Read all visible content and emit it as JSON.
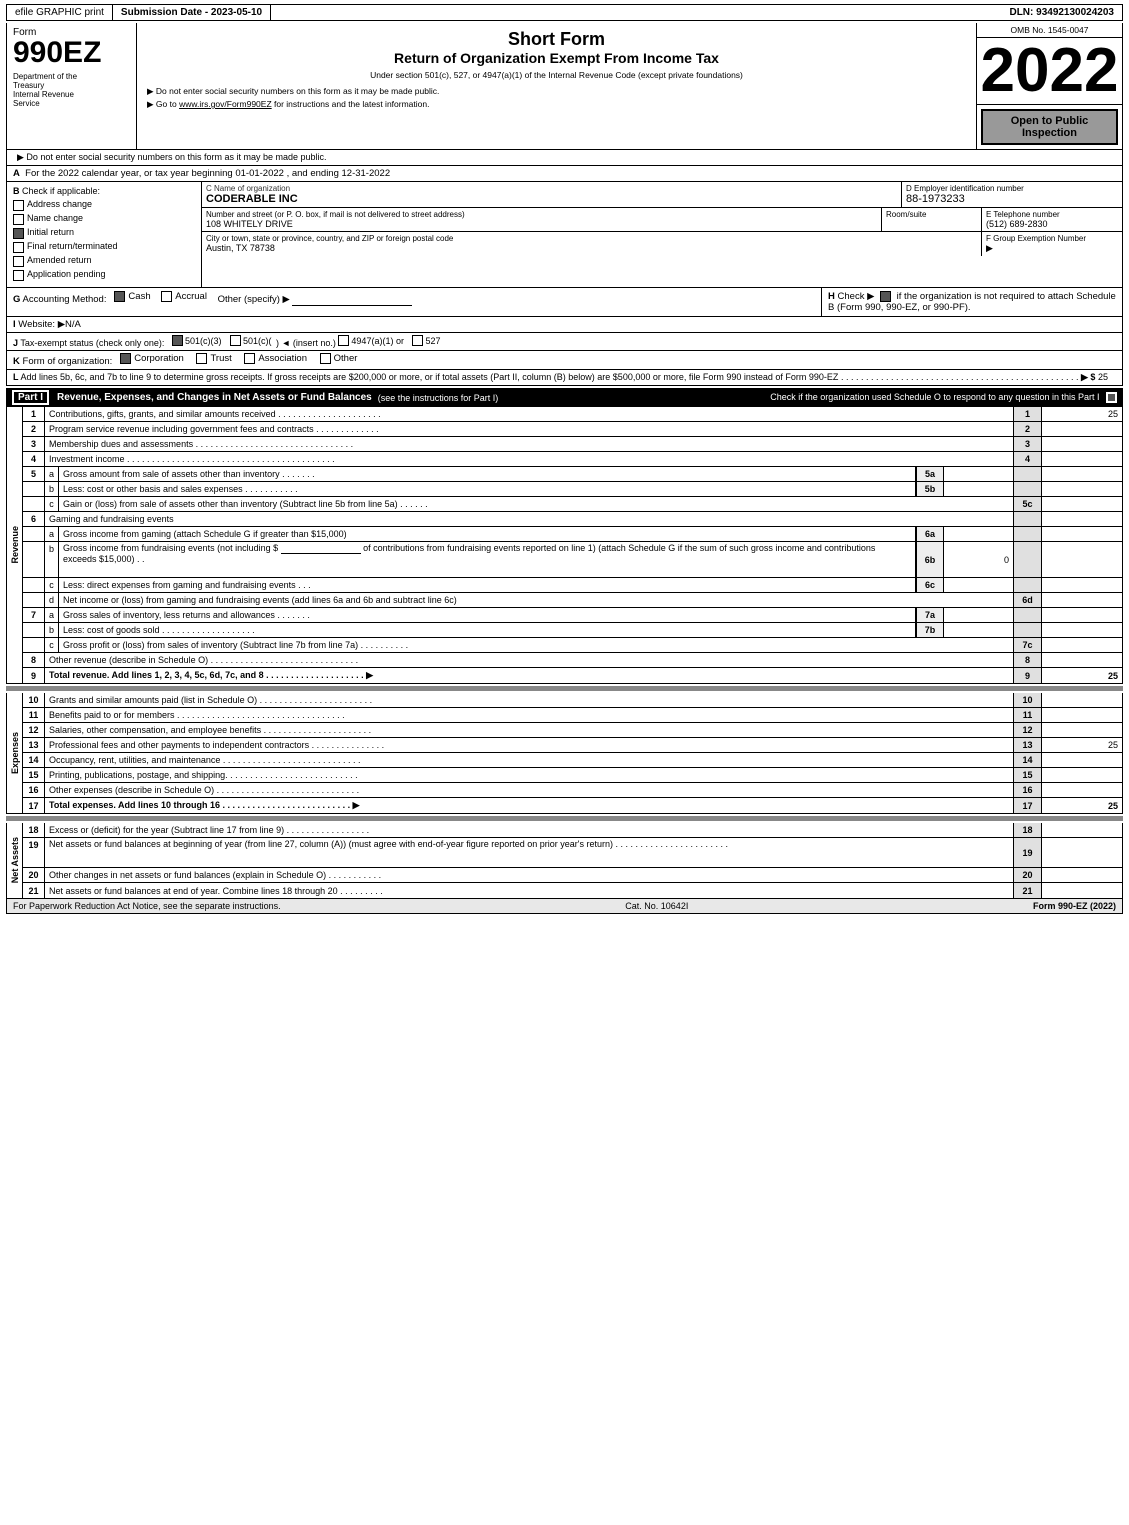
{
  "header": {
    "efile": "efile GRAPHIC print",
    "submission_date_label": "Submission Date - 2023-05-10",
    "dln": "DLN: 93492130024203",
    "form_number": "990EZ",
    "short_form": "Short Form",
    "return_title": "Return of Organization Exempt From Income Tax",
    "under_text": "Under section 501(c), 527, or 4947(a)(1) of the Internal Revenue Code (except private foundations)",
    "ssn_notice": "▶ Do not enter social security numbers on this form as it may be made public.",
    "irs_link": "▶ Go to www.irs.gov/Form990EZ for instructions and the latest information.",
    "year": "2022",
    "omb_label": "OMB No. 1545-0047",
    "open_to_public": "Open to Public Inspection",
    "dept_line1": "Department of the",
    "dept_line2": "Treasury",
    "dept_line3": "Internal Revenue",
    "dept_line4": "Service"
  },
  "section_a": {
    "label": "A",
    "text": "For the 2022 calendar year, or tax year beginning 01-01-2022 , and ending 12-31-2022"
  },
  "section_b": {
    "label": "B",
    "text": "Check if applicable:",
    "items": [
      {
        "label": "Address change",
        "checked": false
      },
      {
        "label": "Name change",
        "checked": false
      },
      {
        "label": "Initial return",
        "checked": true
      },
      {
        "label": "Final return/terminated",
        "checked": false
      },
      {
        "label": "Amended return",
        "checked": false
      },
      {
        "label": "Application pending",
        "checked": false
      }
    ]
  },
  "org": {
    "name_label": "C Name of organization",
    "name": "CODERABLE INC",
    "ein_label": "D Employer identification number",
    "ein": "88-1973233",
    "address_label": "Number and street (or P. O. box, if mail is not delivered to street address)",
    "address": "108 WHITELY DRIVE",
    "room_label": "Room/suite",
    "room": "",
    "phone_label": "E Telephone number",
    "phone": "(512) 689-2830",
    "city_label": "City or town, state or province, country, and ZIP or foreign postal code",
    "city": "Austin, TX  78738",
    "group_label": "F Group Exemption Number",
    "group_arrow": "▶"
  },
  "section_g": {
    "label": "G",
    "text": "Accounting Method:",
    "cash_checked": true,
    "accrual_checked": false,
    "other_text": "Other (specify) ▶"
  },
  "section_h": {
    "label": "H",
    "text": "Check ▶",
    "checked": true,
    "desc": "if the organization is not required to attach Schedule B (Form 990, 990-EZ, or 990-PF)."
  },
  "section_i": {
    "label": "I",
    "text": "Website: ▶N/A"
  },
  "section_j": {
    "label": "J",
    "text": "Tax-exempt status (check only one):",
    "options": [
      {
        "label": "501(c)(3)",
        "checked": true
      },
      {
        "label": "501(c)(",
        "checked": false
      },
      {
        "label": ") ◄ (insert no.)",
        "checked": false
      },
      {
        "label": "4947(a)(1) or",
        "checked": false
      },
      {
        "label": "527",
        "checked": false
      }
    ]
  },
  "section_k": {
    "label": "K",
    "text": "Form of organization:",
    "options": [
      {
        "label": "Corporation",
        "checked": true
      },
      {
        "label": "Trust",
        "checked": false
      },
      {
        "label": "Association",
        "checked": false
      },
      {
        "label": "Other",
        "checked": false
      }
    ]
  },
  "section_l": {
    "label": "L",
    "text": "Add lines 5b, 6c, and 7b to line 9 to determine gross receipts. If gross receipts are $200,000 or more, or if total assets (Part II, column (B) below) are $500,000 or more, file Form 990 instead of Form 990-EZ",
    "dots": ". . . . . . . . . . . . . . . . . . . . . . . . . . . . . . . . . . . . . . . . . . . . . . . .",
    "arrow": "▶ $",
    "amount": "25"
  },
  "part1": {
    "label": "Part I",
    "title": "Revenue, Expenses, and Changes in Net Assets or Fund Balances",
    "see_instructions": "(see the instructions for Part I)",
    "schedule_o_text": "Check if the organization used Schedule O to respond to any question in this Part I",
    "schedule_o_checked": true,
    "rows": [
      {
        "num": "1",
        "sub": "",
        "desc": "Contributions, gifts, grants, and similar amounts received . . . . . . . . . . . . . . . . . . . . .",
        "field": "1",
        "amount": "25"
      },
      {
        "num": "2",
        "sub": "",
        "desc": "Program service revenue including government fees and contracts . . . . . . . . . . . . .",
        "field": "2",
        "amount": ""
      },
      {
        "num": "3",
        "sub": "",
        "desc": "Membership dues and assessments . . . . . . . . . . . . . . . . . . . . . . . . . . . . . . . .",
        "field": "3",
        "amount": ""
      },
      {
        "num": "4",
        "sub": "",
        "desc": "Investment income . . . . . . . . . . . . . . . . . . . . . . . . . . . . . . . . . . . . . . . . . .",
        "field": "4",
        "amount": ""
      },
      {
        "num": "5",
        "sub": "a",
        "desc": "Gross amount from sale of assets other than inventory . . . . . . .",
        "inline_label": "5a",
        "field": "",
        "amount": ""
      },
      {
        "num": "",
        "sub": "b",
        "desc": "Less: cost or other basis and sales expenses . . . . . . . . . . . .",
        "inline_label": "5b",
        "field": "",
        "amount": ""
      },
      {
        "num": "",
        "sub": "c",
        "desc": "Gain or (loss) from sale of assets other than inventory (Subtract line 5b from line 5a) . . . . . .",
        "field": "5c",
        "amount": ""
      },
      {
        "num": "6",
        "sub": "",
        "desc": "Gaming and fundraising events",
        "field": "",
        "amount": ""
      },
      {
        "num": "",
        "sub": "a",
        "desc": "Gross income from gaming (attach Schedule G if greater than $15,000)",
        "inline_label": "6a",
        "field": "",
        "amount": ""
      },
      {
        "num": "",
        "sub": "b",
        "desc": "Gross income from fundraising events (not including $ ______________ of contributions from fundraising events reported on line 1) (attach Schedule G if the sum of such gross income and contributions exceeds $15,000)  .  .",
        "inline_label": "6b",
        "inline_val": "0",
        "field": "",
        "amount": ""
      },
      {
        "num": "",
        "sub": "c",
        "desc": "Less: direct expenses from gaming and fundraising events  .  .  .",
        "inline_label": "6c",
        "field": "",
        "amount": ""
      },
      {
        "num": "",
        "sub": "d",
        "desc": "Net income or (loss) from gaming and fundraising events (add lines 6a and 6b and subtract line 6c)",
        "field": "6d",
        "amount": ""
      },
      {
        "num": "7",
        "sub": "a",
        "desc": "Gross sales of inventory, less returns and allowances . . . . . . .",
        "inline_label": "7a",
        "field": "",
        "amount": ""
      },
      {
        "num": "",
        "sub": "b",
        "desc": "Less: cost of goods sold  .  .  .  .  .  .  .  .  .  .  .  .  .  .  .  .  .  .  .",
        "inline_label": "7b",
        "field": "",
        "amount": ""
      },
      {
        "num": "",
        "sub": "c",
        "desc": "Gross profit or (loss) from sales of inventory (Subtract line 7b from line 7a) . . . . . . . . . .",
        "field": "7c",
        "amount": ""
      },
      {
        "num": "8",
        "sub": "",
        "desc": "Other revenue (describe in Schedule O) . . . . . . . . . . . . . . . . . . . . . . . . . . . . . .",
        "field": "8",
        "amount": ""
      },
      {
        "num": "9",
        "sub": "",
        "desc": "Total revenue. Add lines 1, 2, 3, 4, 5c, 6d, 7c, and 8 . . . . . . . . . . . . . . . . . . . . ▶",
        "field": "9",
        "amount": "25",
        "bold": true
      }
    ]
  },
  "expenses_rows": [
    {
      "num": "10",
      "desc": "Grants and similar amounts paid (list in Schedule O) . . . . . . . . . . . . . . . . . . . . . . .",
      "field": "10",
      "amount": ""
    },
    {
      "num": "11",
      "desc": "Benefits paid to or for members . . . . . . . . . . . . . . . . . . . . . . . . . . . . . . . . . .",
      "field": "11",
      "amount": ""
    },
    {
      "num": "12",
      "desc": "Salaries, other compensation, and employee benefits . . . . . . . . . . . . . . . . . . . . . .",
      "field": "12",
      "amount": ""
    },
    {
      "num": "13",
      "desc": "Professional fees and other payments to independent contractors . . . . . . . . . . . . . . .",
      "field": "13",
      "amount": "25"
    },
    {
      "num": "14",
      "desc": "Occupancy, rent, utilities, and maintenance . . . . . . . . . . . . . . . . . . . . . . . . . . . .",
      "field": "14",
      "amount": ""
    },
    {
      "num": "15",
      "desc": "Printing, publications, postage, and shipping. . . . . . . . . . . . . . . . . . . . . . . . . . .",
      "field": "15",
      "amount": ""
    },
    {
      "num": "16",
      "desc": "Other expenses (describe in Schedule O) . . . . . . . . . . . . . . . . . . . . . . . . . . . . .",
      "field": "16",
      "amount": ""
    },
    {
      "num": "17",
      "desc": "Total expenses. Add lines 10 through 16  . . . . . . . . . . . . . . . . . . . . . . . . . . ▶",
      "field": "17",
      "amount": "25",
      "bold": true
    }
  ],
  "net_assets_rows": [
    {
      "num": "18",
      "desc": "Excess or (deficit) for the year (Subtract line 17 from line 9) . . . . . . . . . . . . . . . . .",
      "field": "18",
      "amount": ""
    },
    {
      "num": "19",
      "desc": "Net assets or fund balances at beginning of year (from line 27, column (A)) (must agree with end-of-year figure reported on prior year's return) . . . . . . . . . . . . . . . . . . . . . . .",
      "field": "19",
      "amount": "",
      "multiline": true
    },
    {
      "num": "20",
      "desc": "Other changes in net assets or fund balances (explain in Schedule O) . . . . . . . . . . .",
      "field": "20",
      "amount": ""
    },
    {
      "num": "21",
      "desc": "Net assets or fund balances at end of year. Combine lines 18 through 20 . . . . . . . . .",
      "field": "21",
      "amount": ""
    }
  ],
  "footer": {
    "paperwork_text": "For Paperwork Reduction Act Notice, see the separate instructions.",
    "cat_no": "Cat. No. 10642I",
    "form_ref": "Form 990-EZ (2022)"
  },
  "revenue_side_label": "Revenue",
  "expenses_side_label": "Expenses",
  "net_assets_side_label": "Net Assets"
}
